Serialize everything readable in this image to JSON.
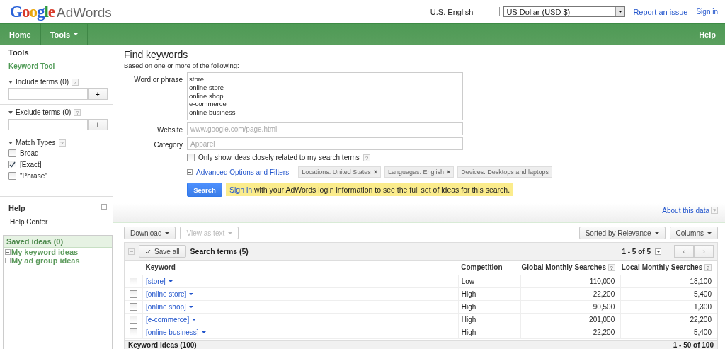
{
  "header": {
    "logo_google": "Google",
    "logo_product": "AdWords",
    "language": "U.S. English",
    "currency": "US Dollar (USD $)",
    "report_link": "Report an issue",
    "sign_in": "Sign in"
  },
  "nav": {
    "items": [
      {
        "label": "Home",
        "dropdown": false
      },
      {
        "label": "Tools",
        "dropdown": true
      }
    ],
    "help": "Help"
  },
  "sidebar": {
    "title": "Tools",
    "active_tool": "Keyword Tool",
    "filters": [
      {
        "label": "Include terms (0)",
        "help": "?",
        "expanded": true,
        "add": "+"
      },
      {
        "label": "Exclude terms (0)",
        "help": "?",
        "expanded": true,
        "add": "+"
      }
    ],
    "match_types": {
      "label": "Match Types",
      "help": "?",
      "expanded": true,
      "options": [
        {
          "label": "Broad",
          "checked": false
        },
        {
          "label": "[Exact]",
          "checked": true
        },
        {
          "label": "\"Phrase\"",
          "checked": false
        }
      ]
    },
    "help": {
      "title": "Help",
      "link": "Help Center"
    },
    "saved": {
      "title": "Saved ideas (0)",
      "items": [
        {
          "label": "My keyword ideas"
        },
        {
          "label": "My ad group ideas"
        }
      ]
    }
  },
  "form": {
    "title": "Find keywords",
    "subtitle": "Based on one or more of the following:",
    "fields": [
      {
        "kind": "textarea",
        "label": "Word or phrase",
        "lines": [
          "store",
          "online store",
          "online shop",
          "e-commerce",
          "online business"
        ]
      },
      {
        "kind": "input",
        "label": "Website",
        "placeholder": "www.google.com/page.html"
      },
      {
        "kind": "input",
        "label": "Category",
        "placeholder": "Apparel"
      }
    ],
    "related_only": {
      "label": "Only show ideas closely related to my search terms",
      "checked": false,
      "help": "?"
    },
    "advanced": {
      "label": "Advanced Options and Filters",
      "expanded": false
    },
    "chips": [
      {
        "label": "Locations:",
        "value": "United States",
        "remove": "×"
      },
      {
        "label": "Languages:",
        "value": "English",
        "remove": "×"
      },
      {
        "label": "Devices:",
        "value": "Desktops and laptops"
      }
    ],
    "search_button": "Search",
    "notice": {
      "link": "Sign in",
      "text": " with your AdWords login information to see the full set of ideas for this search."
    }
  },
  "about": {
    "link": "About this data",
    "help": "?"
  },
  "toolbar": {
    "left": [
      {
        "label": "Download",
        "disabled": false
      },
      {
        "label": "View as text",
        "disabled": true
      }
    ],
    "right": [
      {
        "label": "Sorted by Relevance",
        "disabled": false
      },
      {
        "label": "Columns",
        "disabled": false
      }
    ]
  },
  "search_terms": {
    "save_all": "Save all",
    "title": "Search terms (5)",
    "pager": "1 - 5 of 5",
    "prev": "‹",
    "next": "›",
    "columns": [
      {
        "label": "Keyword"
      },
      {
        "label": "Competition"
      },
      {
        "label": "Global Monthly Searches",
        "help": "?"
      },
      {
        "label": "Local Monthly Searches",
        "help": "?"
      }
    ],
    "rows": [
      {
        "checked": false,
        "keyword": "[store]",
        "competition": "Low",
        "global": "110,000",
        "local": "18,100"
      },
      {
        "checked": false,
        "keyword": "[online store]",
        "competition": "High",
        "global": "22,200",
        "local": "5,400"
      },
      {
        "checked": false,
        "keyword": "[online shop]",
        "competition": "High",
        "global": "90,500",
        "local": "1,300"
      },
      {
        "checked": false,
        "keyword": "[e-commerce]",
        "competition": "High",
        "global": "201,000",
        "local": "22,200"
      },
      {
        "checked": false,
        "keyword": "[online business]",
        "competition": "High",
        "global": "22,200",
        "local": "5,400"
      }
    ]
  },
  "keyword_ideas": {
    "title": "Keyword ideas (100)",
    "pager": "1 - 50 of 100"
  }
}
